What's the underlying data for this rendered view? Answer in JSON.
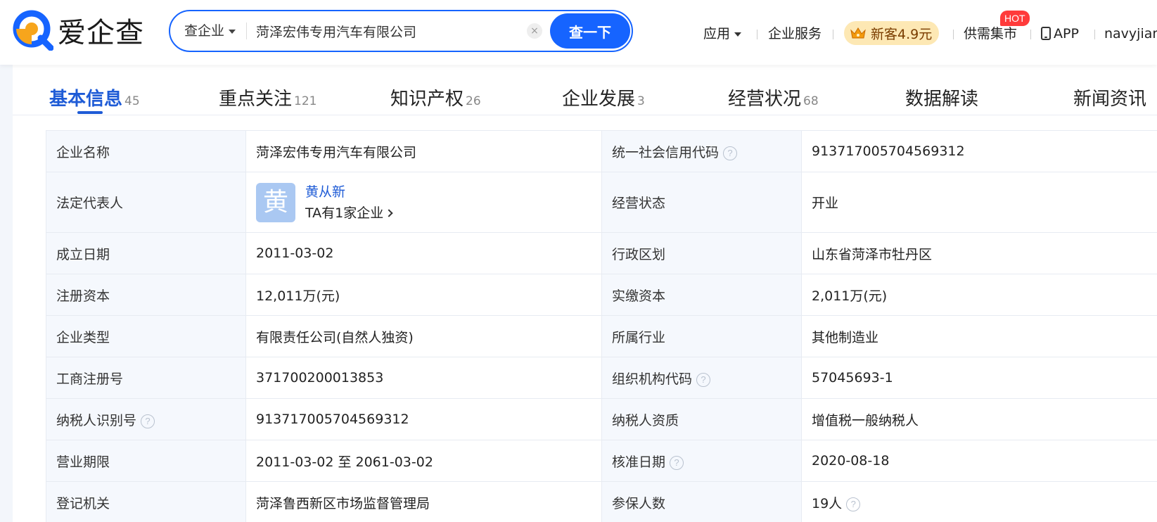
{
  "header": {
    "logo_text": "爱企查",
    "search": {
      "type_label": "查企业",
      "query": "菏泽宏伟专用汽车有限公司",
      "clear_symbol": "×",
      "button_label": "查一下"
    },
    "nav": {
      "apps_label": "应用",
      "enterprise_services_label": "企业服务",
      "vip_label": "新客4.9元",
      "supply_market_label": "供需集市",
      "hot_badge": "HOT",
      "app_label": "APP",
      "username": "navyjiang"
    }
  },
  "tabs": [
    {
      "label": "基本信息",
      "count": "45",
      "active": true
    },
    {
      "label": "重点关注",
      "count": "121"
    },
    {
      "label": "知识产权",
      "count": "26"
    },
    {
      "label": "企业发展",
      "count": "3"
    },
    {
      "label": "经营状况",
      "count": "68"
    },
    {
      "label": "数据解读",
      "count": ""
    },
    {
      "label": "新闻资讯",
      "count": ""
    }
  ],
  "info": {
    "company_name_label": "企业名称",
    "company_name": "菏泽宏伟专用汽车有限公司",
    "credit_code_label": "统一社会信用代码",
    "credit_code": "913717005704569312",
    "legal_rep_label": "法定代表人",
    "legal_rep_avatar": "黄",
    "legal_rep_name": "黄从新",
    "legal_rep_companies": "TA有1家企业",
    "status_label": "经营状态",
    "status": "开业",
    "founded_label": "成立日期",
    "founded": "2011-03-02",
    "region_label": "行政区划",
    "region": "山东省菏泽市牡丹区",
    "reg_capital_label": "注册资本",
    "reg_capital": "12,011万(元)",
    "paid_capital_label": "实缴资本",
    "paid_capital": "2,011万(元)",
    "type_label": "企业类型",
    "type": "有限责任公司(自然人独资)",
    "industry_label": "所属行业",
    "industry": "其他制造业",
    "biz_reg_no_label": "工商注册号",
    "biz_reg_no": "371700200013853",
    "org_code_label": "组织机构代码",
    "org_code": "57045693-1",
    "taxpayer_id_label": "纳税人识别号",
    "taxpayer_id": "913717005704569312",
    "taxpayer_qual_label": "纳税人资质",
    "taxpayer_qual": "增值税一般纳税人",
    "term_label": "营业期限",
    "term": "2011-03-02 至 2061-03-02",
    "approval_date_label": "核准日期",
    "approval_date": "2020-08-18",
    "authority_label": "登记机关",
    "authority": "菏泽鲁西新区市场监督管理局",
    "insured_label": "参保人数",
    "insured": "19人"
  },
  "colors": {
    "brand_blue": "#1664ff",
    "link_blue": "#1e5bd6",
    "logo_orange": "#f7a51c",
    "hot_red": "#ff3b3b"
  },
  "icons": [
    "logo-q-icon",
    "caret-down-icon",
    "clear-icon",
    "crown-icon",
    "phone-icon",
    "question-icon",
    "chevron-right-icon"
  ]
}
